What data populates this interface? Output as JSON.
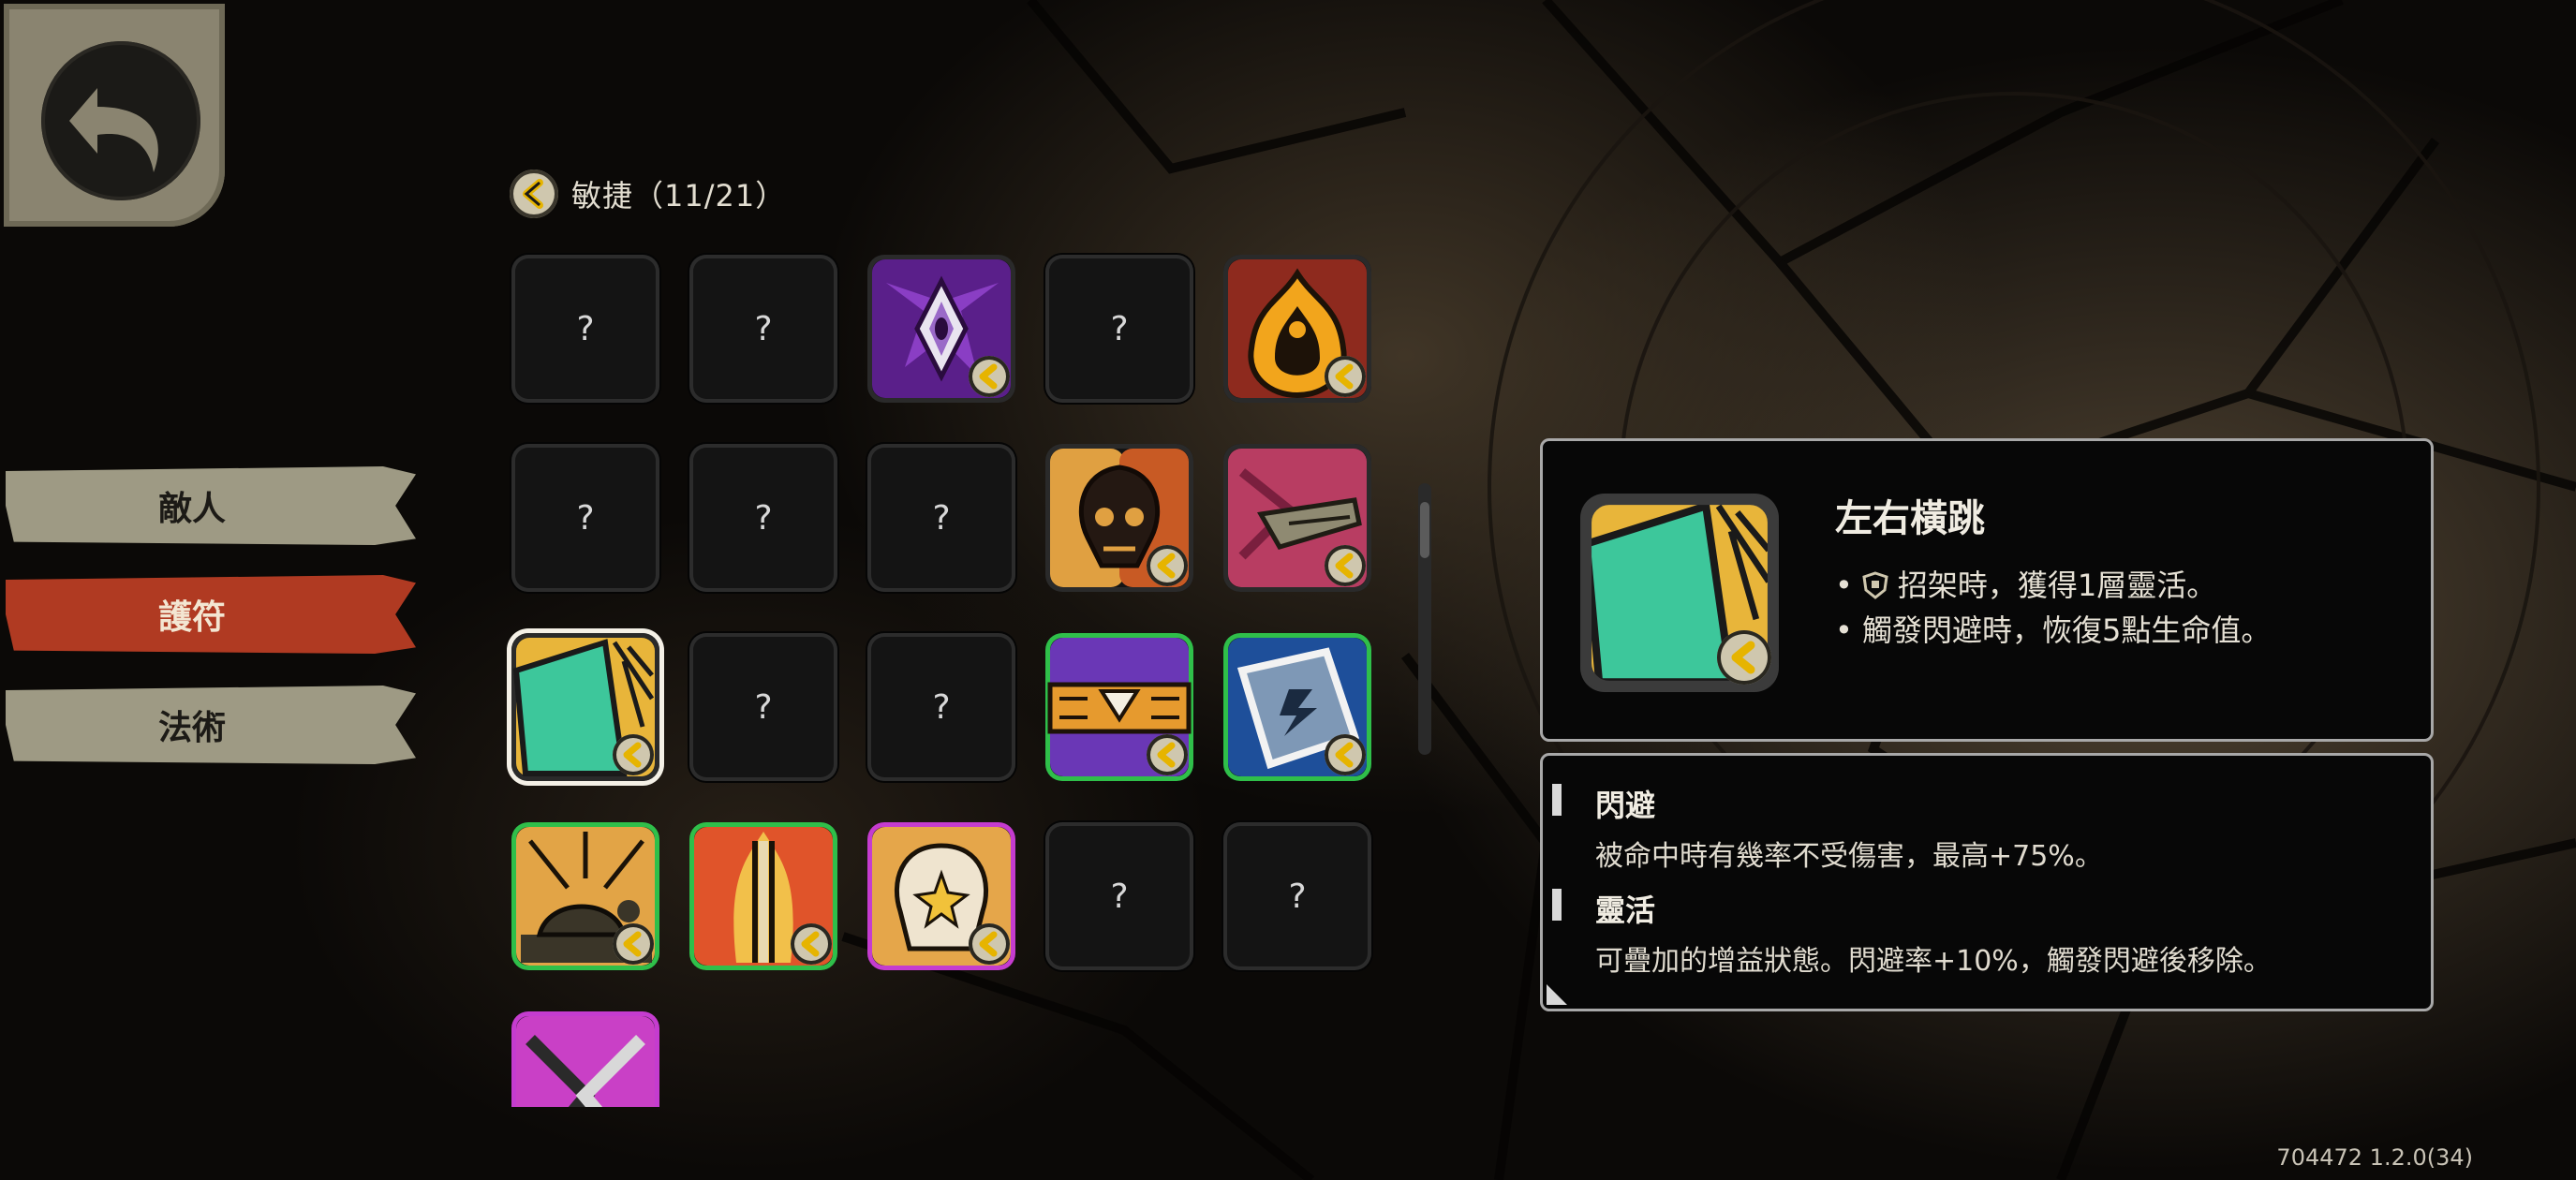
{
  "side_nav": {
    "items": [
      {
        "label": "敵人"
      },
      {
        "label": "護符"
      },
      {
        "label": "法術"
      }
    ],
    "active_color": "#b03a22",
    "inactive_color": "#9e9a84"
  },
  "category": {
    "title": "敏捷（11/21）",
    "badge_icon": "chevron-left-icon"
  },
  "grid": {
    "unknown_label": "?"
  },
  "detail": {
    "name": "左右橫跳",
    "line1": "招架時，獲得1層靈活。",
    "line2": "• 觸發閃避時，恢復5點生命值。",
    "bullet": "•",
    "keywords": [
      {
        "title": "閃避",
        "desc": "被命中時有幾率不受傷害，最高+75%。"
      },
      {
        "title": "靈活",
        "desc": "可疊加的增益狀態。閃避率+10%，觸發閃避後移除。"
      }
    ]
  },
  "version": "704472 1.2.0(34)"
}
